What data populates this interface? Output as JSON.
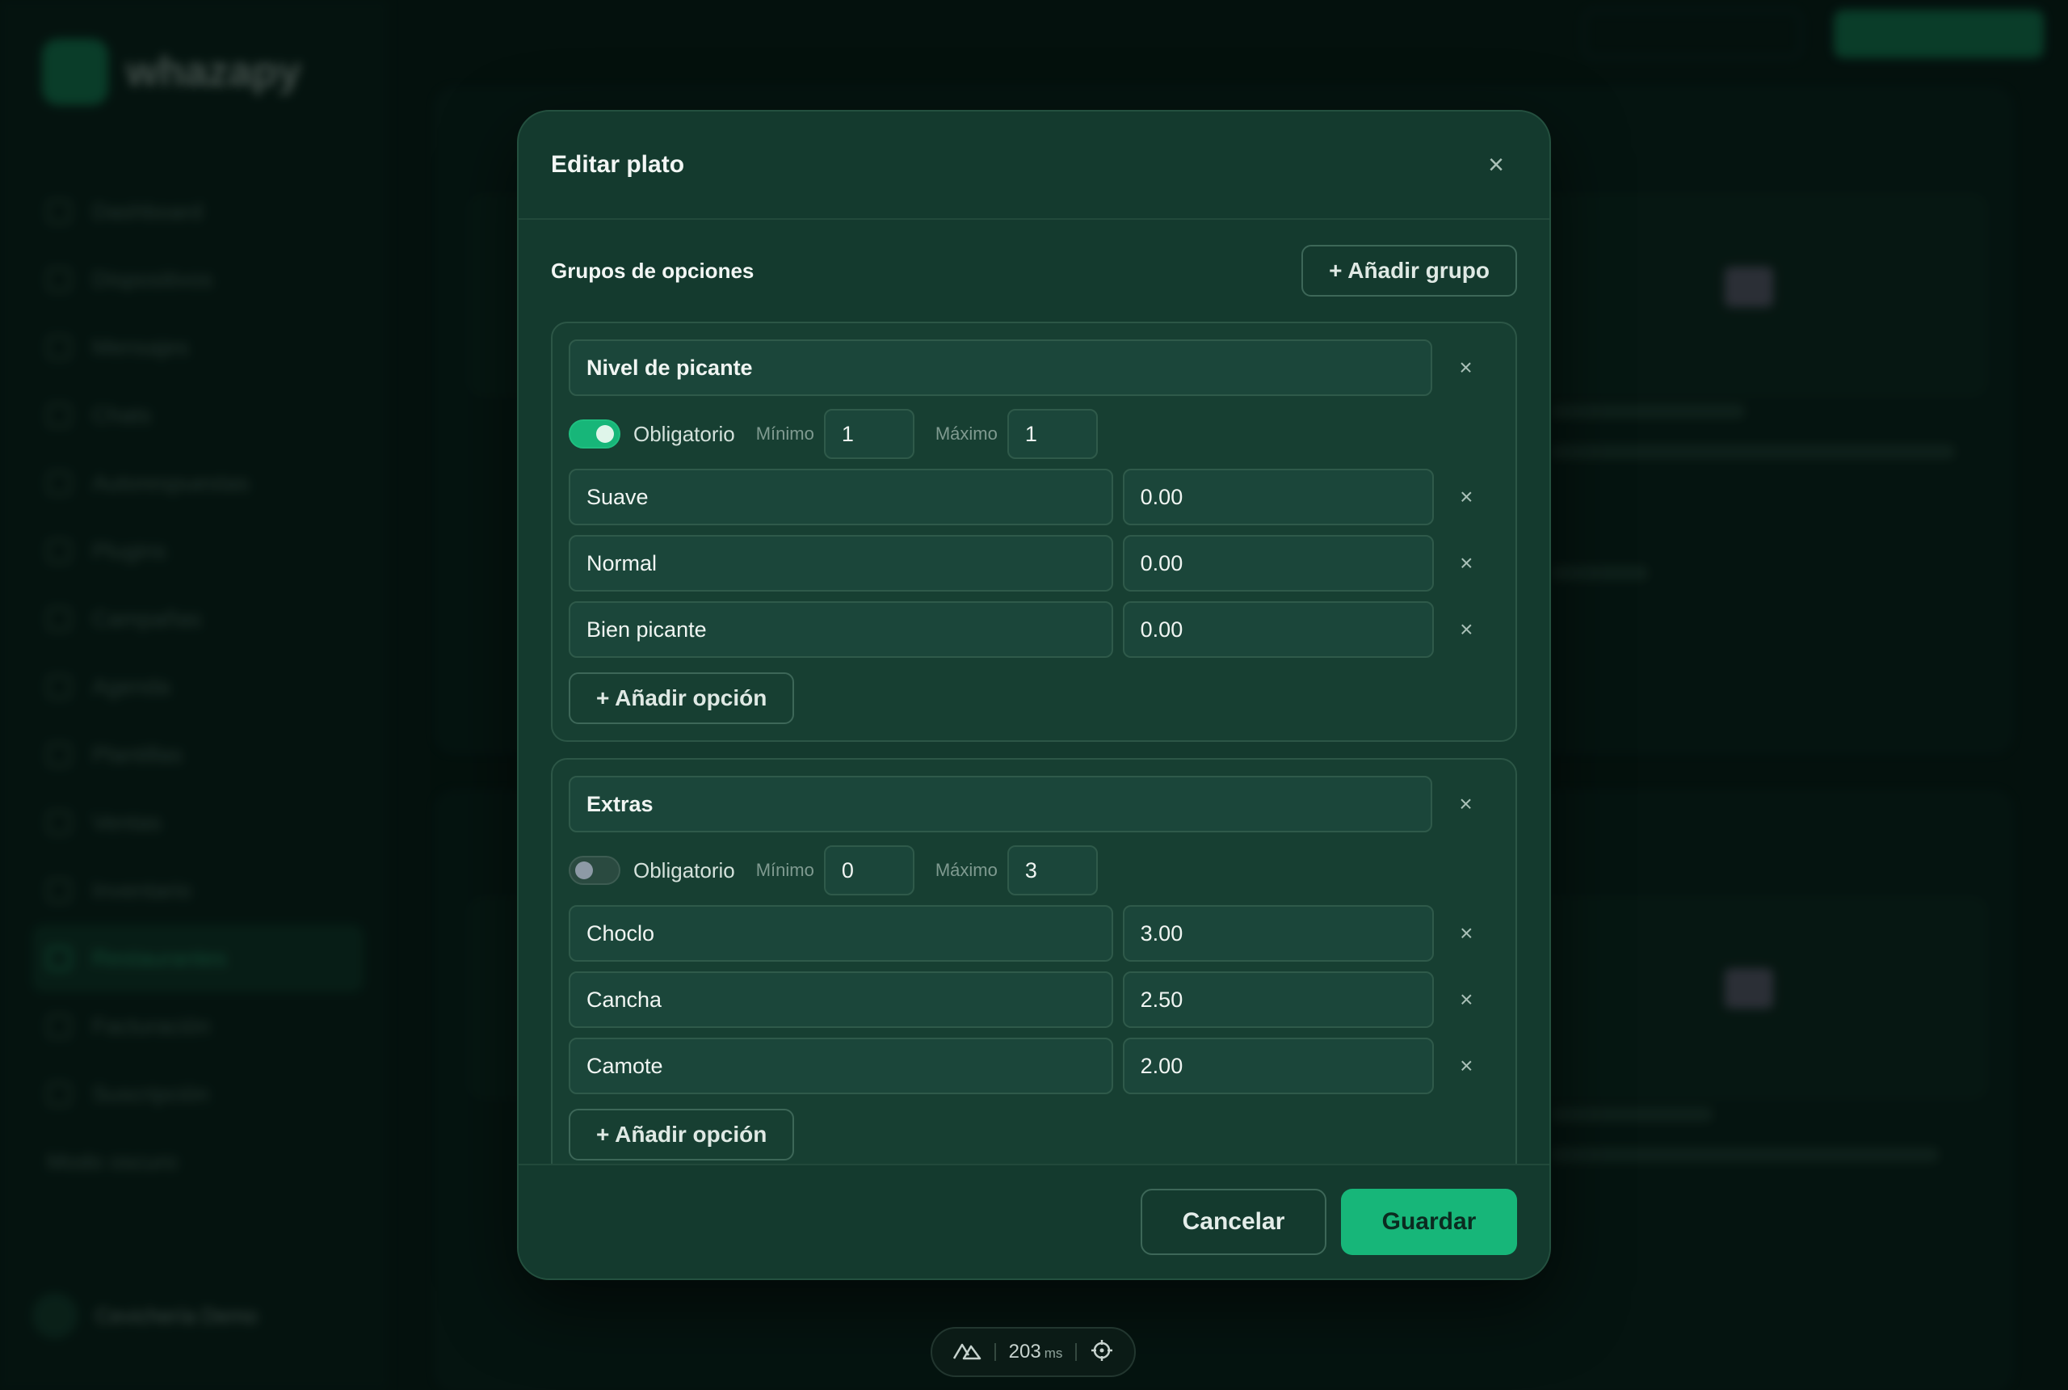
{
  "background": {
    "brand": "whazapy",
    "nav_items": [
      "Dashboard",
      "Dispositivos",
      "Mensajes",
      "Chats",
      "Autorespuestas",
      "Plugins",
      "Campañas",
      "Agenda",
      "Plantillas",
      "Ventas",
      "Inventario",
      "Restaurantes",
      "Facturación",
      "Suscripción"
    ],
    "active_nav_index": 11,
    "dark_mode_label": "Modo oscuro",
    "user_name": "Cevichería Demo"
  },
  "modal": {
    "title": "Editar plato",
    "close_icon": "close-icon",
    "section_title": "Grupos de opciones",
    "add_group_label": "+ Añadir grupo",
    "required_label": "Obligatorio",
    "min_label": "Mínimo",
    "max_label": "Máximo",
    "add_option_label": "+ Añadir opción",
    "groups": [
      {
        "name": "Nivel de picante",
        "required": true,
        "min": "1",
        "max": "1",
        "options": [
          {
            "name": "Suave",
            "price": "0.00"
          },
          {
            "name": "Normal",
            "price": "0.00"
          },
          {
            "name": "Bien picante",
            "price": "0.00"
          }
        ]
      },
      {
        "name": "Extras",
        "required": false,
        "min": "0",
        "max": "3",
        "options": [
          {
            "name": "Choclo",
            "price": "3.00"
          },
          {
            "name": "Cancha",
            "price": "2.50"
          },
          {
            "name": "Camote",
            "price": "2.00"
          }
        ]
      }
    ],
    "cancel_label": "Cancelar",
    "save_label": "Guardar"
  },
  "devbar": {
    "time_value": "203",
    "time_unit": "ms"
  },
  "colors": {
    "accent": "#17b679",
    "modal_bg": "#143a2e",
    "page_bg": "#061612"
  }
}
